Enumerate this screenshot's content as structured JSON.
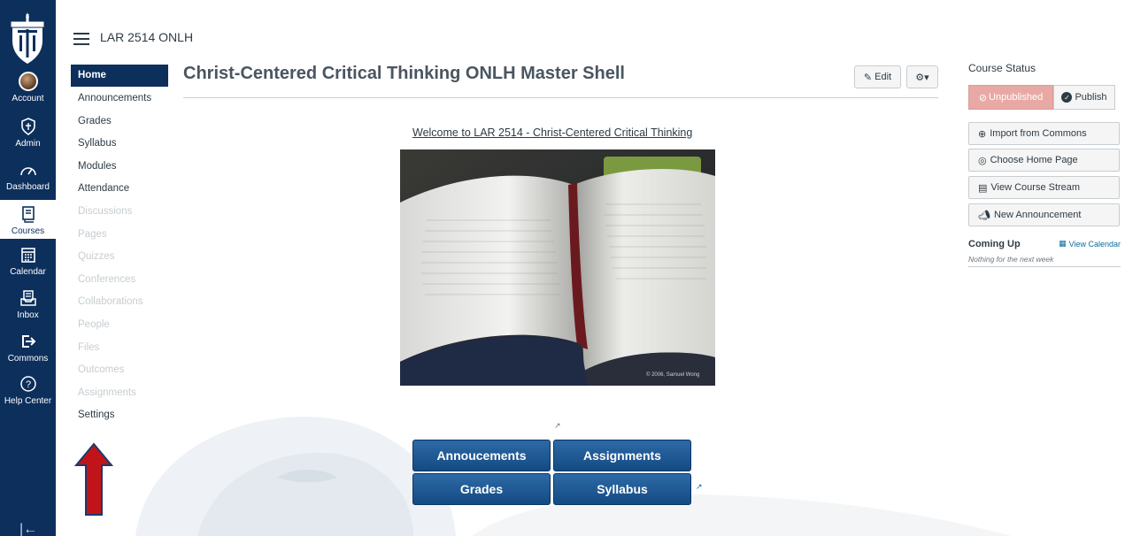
{
  "global_nav": {
    "items": [
      {
        "label": "Account",
        "icon": "avatar"
      },
      {
        "label": "Admin",
        "icon": "shield-icon"
      },
      {
        "label": "Dashboard",
        "icon": "dashboard-icon"
      },
      {
        "label": "Courses",
        "icon": "courses-icon"
      },
      {
        "label": "Calendar",
        "icon": "calendar-icon"
      },
      {
        "label": "Inbox",
        "icon": "inbox-icon"
      },
      {
        "label": "Commons",
        "icon": "commons-icon"
      },
      {
        "label": "Help Center",
        "icon": "help-icon"
      }
    ],
    "logo_text": "·1873·",
    "colors": {
      "background": "#0c2f5c",
      "active": "#ffffff"
    }
  },
  "header": {
    "breadcrumb": "LAR 2514 ONLH"
  },
  "course_nav": {
    "items": [
      {
        "label": "Home",
        "state": "active"
      },
      {
        "label": "Announcements",
        "state": "enabled"
      },
      {
        "label": "Grades",
        "state": "enabled"
      },
      {
        "label": "Syllabus",
        "state": "enabled"
      },
      {
        "label": "Modules",
        "state": "enabled"
      },
      {
        "label": "Attendance",
        "state": "enabled"
      },
      {
        "label": "Discussions",
        "state": "disabled"
      },
      {
        "label": "Pages",
        "state": "disabled"
      },
      {
        "label": "Quizzes",
        "state": "disabled"
      },
      {
        "label": "Conferences",
        "state": "disabled"
      },
      {
        "label": "Collaborations",
        "state": "disabled"
      },
      {
        "label": "People",
        "state": "disabled"
      },
      {
        "label": "Files",
        "state": "disabled"
      },
      {
        "label": "Outcomes",
        "state": "disabled"
      },
      {
        "label": "Assignments",
        "state": "disabled"
      },
      {
        "label": "Settings",
        "state": "enabled"
      }
    ]
  },
  "main": {
    "title": "Christ-Centered Critical Thinking ONLH Master Shell",
    "edit_label": "Edit",
    "welcome_text": "Welcome to LAR 2514 - Christ-Centered Critical Thinking",
    "photo_credit": "© 2006, Samuel Wong",
    "nav_buttons": [
      "Annoucements",
      "Assignments",
      "Grades",
      "Syllabus"
    ]
  },
  "sidebar": {
    "course_status_label": "Course Status",
    "unpublished_label": "Unpublished",
    "publish_label": "Publish",
    "actions": [
      {
        "label": "Import from Commons",
        "icon": "commons-import-icon"
      },
      {
        "label": "Choose Home Page",
        "icon": "target-icon"
      },
      {
        "label": "View Course Stream",
        "icon": "stream-icon"
      },
      {
        "label": "New Announcement",
        "icon": "megaphone-icon"
      }
    ],
    "coming_up_label": "Coming Up",
    "view_calendar_label": "View Calendar",
    "nothing_label": "Nothing for the next week"
  },
  "colors": {
    "unpublished_bg": "#e8a9a5",
    "button_blue": "#1f5a96",
    "annotation_arrow": "#c0141a"
  }
}
